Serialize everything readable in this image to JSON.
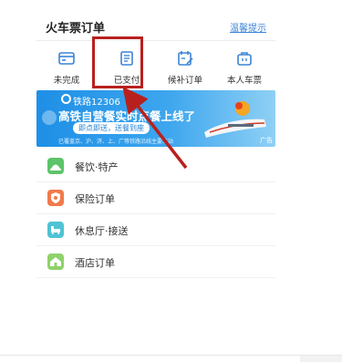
{
  "header": {
    "title": "火车票订单",
    "link": "温馨提示"
  },
  "tabs": [
    {
      "label": "未完成",
      "icon": "card-icon"
    },
    {
      "label": "已支付",
      "icon": "document-icon"
    },
    {
      "label": "候补订单",
      "icon": "calendar-edit-icon"
    },
    {
      "label": "本人车票",
      "icon": "suitcase-icon"
    }
  ],
  "banner": {
    "brand": "铁路12306",
    "headline": "高铁自营餐实时点餐上线了",
    "button": "即点即送，送餐到座",
    "fine_print": "已覆盖京、沪、济、上、广等铁路沿线主要车站",
    "ad": "广告"
  },
  "menu": [
    {
      "label": "餐饮·特产",
      "icon": "food-icon",
      "color": "#5cc46a"
    },
    {
      "label": "保险订单",
      "icon": "shield-icon",
      "color": "#f07a4a"
    },
    {
      "label": "休息厅·接送",
      "icon": "lounge-icon",
      "color": "#4fc3d4"
    },
    {
      "label": "酒店订单",
      "icon": "hotel-icon",
      "color": "#8fd26a"
    }
  ],
  "colors": {
    "accent": "#3b84d6",
    "highlight": "#b8201e",
    "banner": "#1e8fe6"
  }
}
